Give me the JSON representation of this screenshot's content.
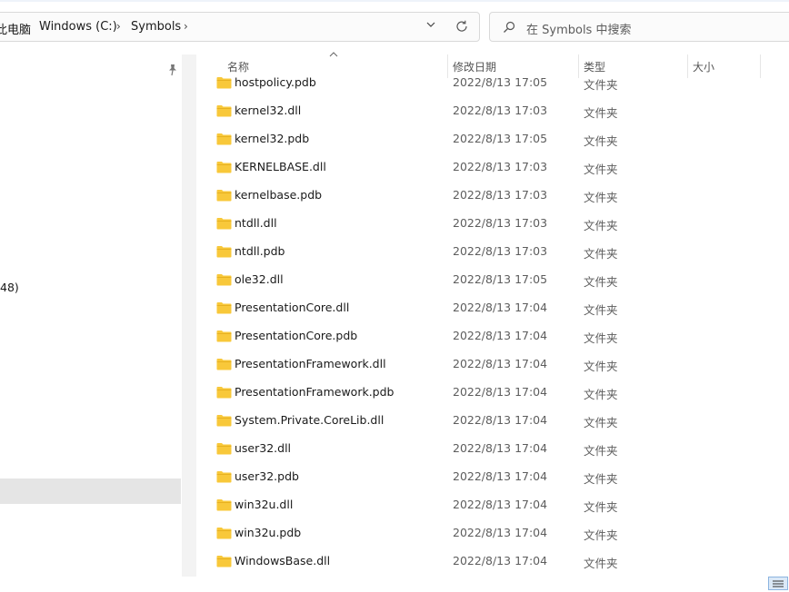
{
  "address": {
    "crumbs": [
      "此电脑",
      "Windows (C:)",
      "Symbols"
    ]
  },
  "search": {
    "placeholder": "在 Symbols 中搜索"
  },
  "nav": {
    "partial_text": "48)"
  },
  "columns": {
    "name": "名称",
    "date": "修改日期",
    "type": "类型",
    "size": "大小"
  },
  "files": [
    {
      "name": "hostpolicy.pdb",
      "date": "2022/8/13 17:05",
      "type": "文件夹"
    },
    {
      "name": "kernel32.dll",
      "date": "2022/8/13 17:03",
      "type": "文件夹"
    },
    {
      "name": "kernel32.pdb",
      "date": "2022/8/13 17:05",
      "type": "文件夹"
    },
    {
      "name": "KERNELBASE.dll",
      "date": "2022/8/13 17:03",
      "type": "文件夹"
    },
    {
      "name": "kernelbase.pdb",
      "date": "2022/8/13 17:03",
      "type": "文件夹"
    },
    {
      "name": "ntdll.dll",
      "date": "2022/8/13 17:03",
      "type": "文件夹"
    },
    {
      "name": "ntdll.pdb",
      "date": "2022/8/13 17:03",
      "type": "文件夹"
    },
    {
      "name": "ole32.dll",
      "date": "2022/8/13 17:05",
      "type": "文件夹"
    },
    {
      "name": "PresentationCore.dll",
      "date": "2022/8/13 17:04",
      "type": "文件夹"
    },
    {
      "name": "PresentationCore.pdb",
      "date": "2022/8/13 17:04",
      "type": "文件夹"
    },
    {
      "name": "PresentationFramework.dll",
      "date": "2022/8/13 17:04",
      "type": "文件夹"
    },
    {
      "name": "PresentationFramework.pdb",
      "date": "2022/8/13 17:04",
      "type": "文件夹"
    },
    {
      "name": "System.Private.CoreLib.dll",
      "date": "2022/8/13 17:04",
      "type": "文件夹"
    },
    {
      "name": "user32.dll",
      "date": "2022/8/13 17:04",
      "type": "文件夹"
    },
    {
      "name": "user32.pdb",
      "date": "2022/8/13 17:04",
      "type": "文件夹"
    },
    {
      "name": "win32u.dll",
      "date": "2022/8/13 17:04",
      "type": "文件夹"
    },
    {
      "name": "win32u.pdb",
      "date": "2022/8/13 17:04",
      "type": "文件夹"
    },
    {
      "name": "WindowsBase.dll",
      "date": "2022/8/13 17:04",
      "type": "文件夹"
    }
  ],
  "colors": {
    "folder_yellow": "#f8c83a",
    "selection_gray": "#e5e5e5"
  }
}
